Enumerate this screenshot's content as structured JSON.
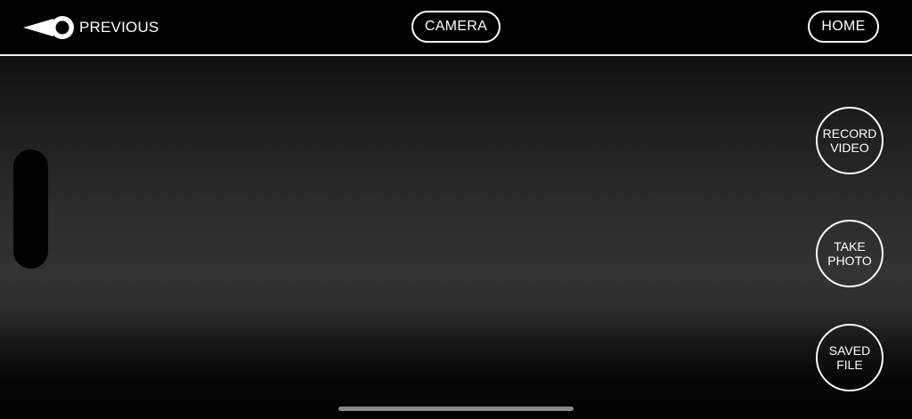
{
  "header": {
    "back_label": "PREVIOUS",
    "back_icon": "back-arrow-icon",
    "title": "CAMERA",
    "home_label": "HOME"
  },
  "controls": {
    "record_video": [
      "RECORD",
      "VIDEO"
    ],
    "take_photo": [
      "TAKE",
      "PHOTO"
    ],
    "saved_file": [
      "SAVED",
      "FILE"
    ]
  },
  "colors": {
    "background": "#000000",
    "foreground": "#ffffff",
    "home_indicator": "#8a8a8a"
  }
}
